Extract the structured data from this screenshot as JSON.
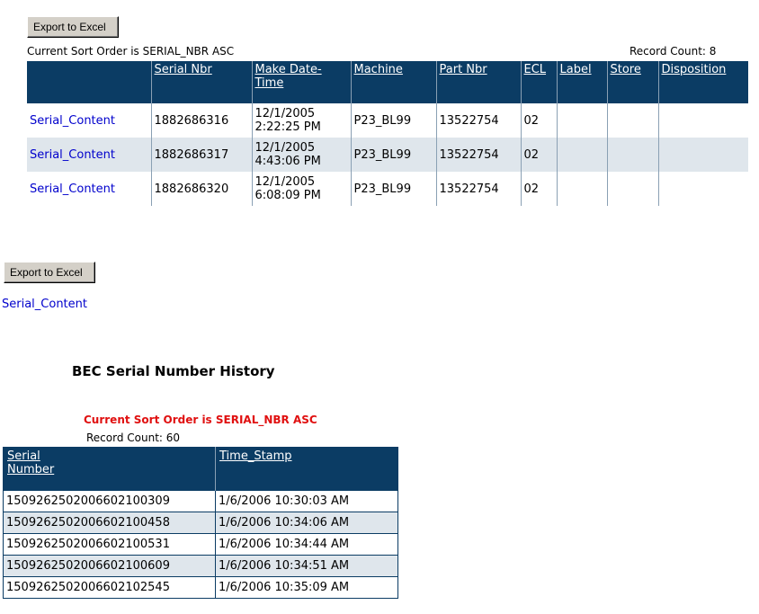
{
  "top": {
    "export_label": "Export to Excel",
    "sort_text": "Current Sort Order is SERIAL_NBR ASC",
    "record_count": "Record Count: 8",
    "headers": {
      "serial_nbr": "Serial Nbr",
      "make_date": "Make Date-Time",
      "machine": "Machine",
      "part_nbr": "Part Nbr",
      "ecl": "ECL",
      "label": "Label",
      "store": "Store",
      "disposition": "Disposition"
    },
    "rows": [
      {
        "link": "Serial_Content",
        "serial": "1882686316",
        "date": "12/1/2005",
        "time": "2:22:25 PM",
        "machine": "P23_BL99",
        "part": "13522754",
        "ecl": "02",
        "label": "",
        "store": "",
        "disposition": ""
      },
      {
        "link": "Serial_Content",
        "serial": "1882686317",
        "date": "12/1/2005",
        "time": "4:43:06 PM",
        "machine": "P23_BL99",
        "part": "13522754",
        "ecl": "02",
        "label": "",
        "store": "",
        "disposition": ""
      },
      {
        "link": "Serial_Content",
        "serial": "1882686320",
        "date": "12/1/2005",
        "time": "6:08:09 PM",
        "machine": "P23_BL99",
        "part": "13522754",
        "ecl": "02",
        "label": "",
        "store": "",
        "disposition": ""
      }
    ]
  },
  "middle": {
    "export_label": "Export to Excel",
    "serial_link": "Serial_Content"
  },
  "history": {
    "title": "BEC Serial Number History",
    "sort_text": "Current Sort Order is SERIAL_NBR ASC",
    "record_count": "Record Count: 60",
    "headers": {
      "serial_number": "Serial Number",
      "time_stamp": "Time_Stamp"
    },
    "rows": [
      {
        "serial": "1509262502006602100309",
        "stamp": "1/6/2006 10:30:03 AM"
      },
      {
        "serial": "1509262502006602100458",
        "stamp": "1/6/2006 10:34:06 AM"
      },
      {
        "serial": "1509262502006602100531",
        "stamp": "1/6/2006 10:34:44 AM"
      },
      {
        "serial": "1509262502006602100609",
        "stamp": "1/6/2006 10:34:51 AM"
      },
      {
        "serial": "1509262502006602102545",
        "stamp": "1/6/2006 10:35:09 AM"
      }
    ]
  },
  "colors": {
    "header_bg": "#0b3c64",
    "alt_row_bg": "#dfe6ec",
    "link": "#0000cc",
    "sort_warning": "#e01010"
  }
}
